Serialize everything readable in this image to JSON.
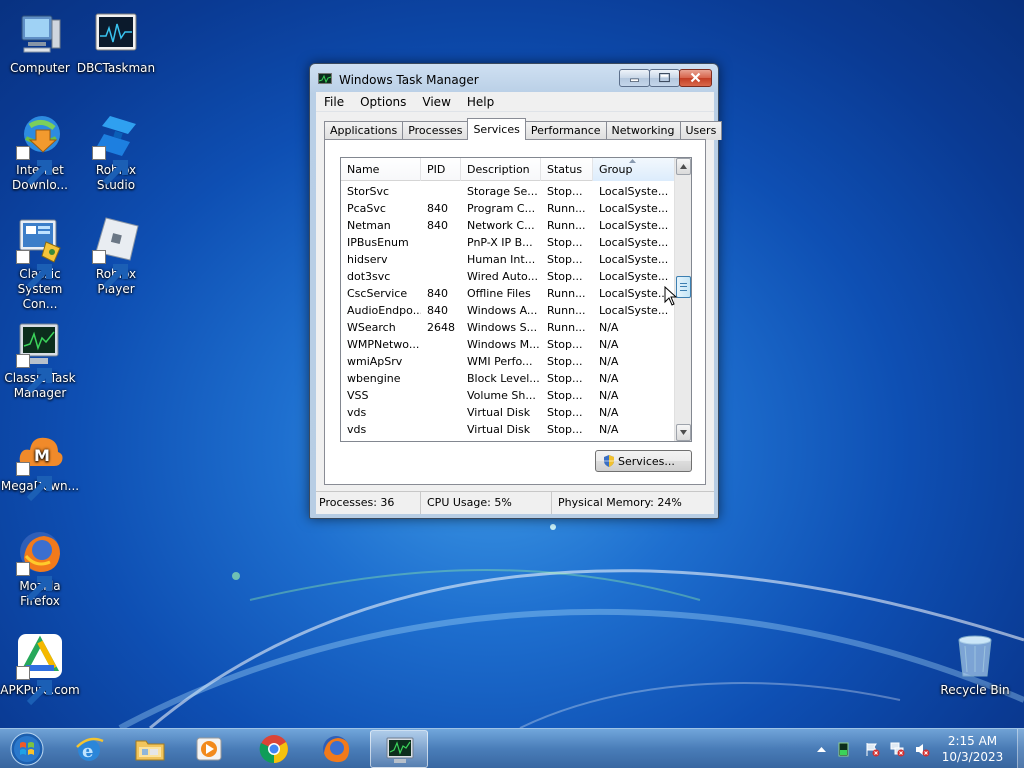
{
  "desktop": {
    "icons": [
      {
        "label": "Computer",
        "icon": "computer-icon"
      },
      {
        "label": "DBCTaskman",
        "icon": "taskman-monitor-icon"
      },
      {
        "label": "Internet Downlo...",
        "icon": "internet-download-manager-icon"
      },
      {
        "label": "Roblox Studio",
        "icon": "roblox-studio-icon"
      },
      {
        "label": "Classic System Con...",
        "icon": "control-panel-icon"
      },
      {
        "label": "Roblox Player",
        "icon": "roblox-player-icon"
      },
      {
        "label": "Classic Task Manager",
        "icon": "task-manager-icon"
      },
      {
        "label": "MegaDown...",
        "icon": "mega-cloud-icon"
      },
      {
        "label": "Mozilla Firefox",
        "icon": "firefox-icon"
      },
      {
        "label": "APKPure.com",
        "icon": "apkpure-icon"
      },
      {
        "label": "Recycle Bin",
        "icon": "recycle-bin-icon"
      }
    ]
  },
  "window": {
    "title": "Windows Task Manager",
    "menu": [
      "File",
      "Options",
      "View",
      "Help"
    ],
    "tabs": [
      "Applications",
      "Processes",
      "Services",
      "Performance",
      "Networking",
      "Users"
    ],
    "active_tab": "Services",
    "columns": [
      "Name",
      "PID",
      "Description",
      "Status",
      "Group"
    ],
    "rows": [
      {
        "name": "StorSvc",
        "pid": "",
        "description": "Storage Se...",
        "status": "Stop...",
        "group": "LocalSyste..."
      },
      {
        "name": "PcaSvc",
        "pid": "840",
        "description": "Program C...",
        "status": "Runn...",
        "group": "LocalSyste..."
      },
      {
        "name": "Netman",
        "pid": "840",
        "description": "Network C...",
        "status": "Runn...",
        "group": "LocalSyste..."
      },
      {
        "name": "IPBusEnum",
        "pid": "",
        "description": "PnP-X IP B...",
        "status": "Stop...",
        "group": "LocalSyste..."
      },
      {
        "name": "hidserv",
        "pid": "",
        "description": "Human Int...",
        "status": "Stop...",
        "group": "LocalSyste..."
      },
      {
        "name": "dot3svc",
        "pid": "",
        "description": "Wired Auto...",
        "status": "Stop...",
        "group": "LocalSyste..."
      },
      {
        "name": "CscService",
        "pid": "840",
        "description": "Offline Files",
        "status": "Runn...",
        "group": "LocalSyste..."
      },
      {
        "name": "AudioEndpo...",
        "pid": "840",
        "description": "Windows A...",
        "status": "Runn...",
        "group": "LocalSyste..."
      },
      {
        "name": "WSearch",
        "pid": "2648",
        "description": "Windows S...",
        "status": "Runn...",
        "group": "N/A"
      },
      {
        "name": "WMPNetwo...",
        "pid": "",
        "description": "Windows M...",
        "status": "Stop...",
        "group": "N/A"
      },
      {
        "name": "wmiApSrv",
        "pid": "",
        "description": "WMI Perfo...",
        "status": "Stop...",
        "group": "N/A"
      },
      {
        "name": "wbengine",
        "pid": "",
        "description": "Block Level...",
        "status": "Stop...",
        "group": "N/A"
      },
      {
        "name": "VSS",
        "pid": "",
        "description": "Volume Sh...",
        "status": "Stop...",
        "group": "N/A"
      },
      {
        "name": "vds",
        "pid": "",
        "description": "Virtual Disk",
        "status": "Stop...",
        "group": "N/A"
      },
      {
        "name": "vds",
        "pid": "",
        "description": "Virtual Disk",
        "status": "Stop...",
        "group": "N/A"
      }
    ],
    "services_button": "Services...",
    "status": {
      "processes": "Processes: 36",
      "cpu": "CPU Usage: 5%",
      "memory": "Physical Memory: 24%"
    }
  },
  "taskbar": {
    "pinned": [
      "internet-explorer-icon",
      "file-explorer-icon",
      "media-player-icon",
      "chrome-icon",
      "firefox-icon",
      "task-manager-icon"
    ],
    "clock_time": "2:15 AM",
    "clock_date": "10/3/2023"
  },
  "colors": {
    "desktop_blue": "#1e6fcf",
    "close_red": "#c23d24",
    "selection_blue": "#3c7fb1"
  }
}
